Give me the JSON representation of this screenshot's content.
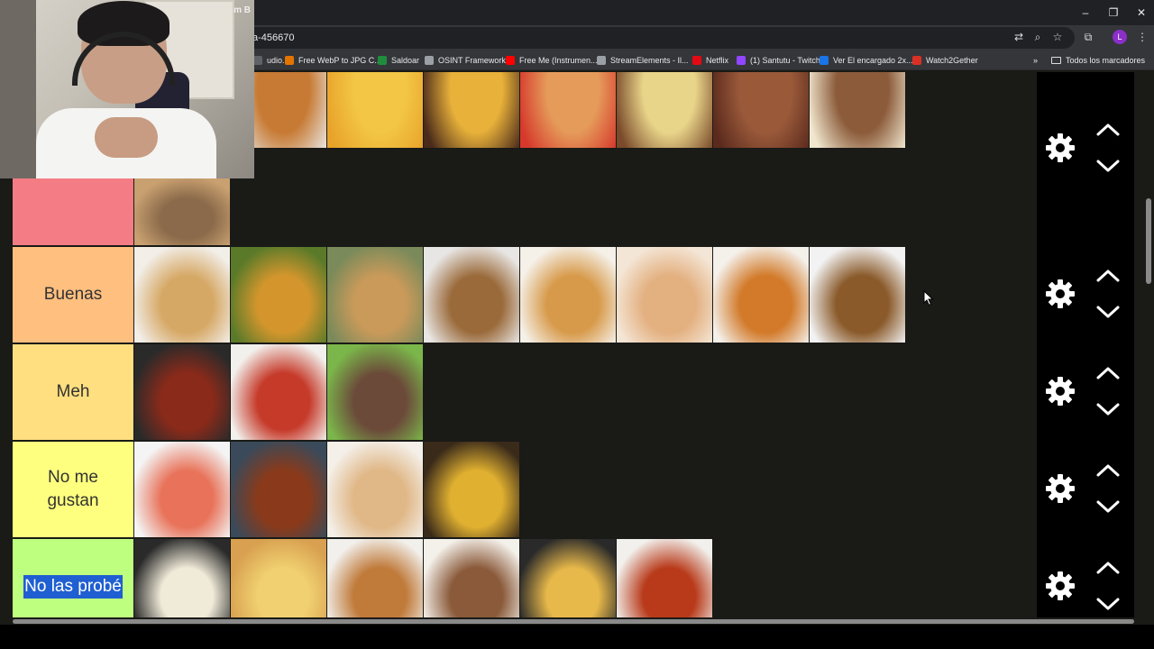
{
  "browser": {
    "url_fragment": "a-456670",
    "window_controls": {
      "minimize": "–",
      "restore": "❐",
      "close": "✕"
    },
    "profile_initial": "L",
    "bookmarks": [
      {
        "label": "udio...",
        "color": "#5f6368"
      },
      {
        "label": "Free WebP to JPG C...",
        "color": "#e37400"
      },
      {
        "label": "Saldoar",
        "color": "#1e8e3e"
      },
      {
        "label": "OSINT Framework",
        "color": "#9aa0a6"
      },
      {
        "label": "Free Me (Instrumen...",
        "color": "#ff0000"
      },
      {
        "label": "StreamElements - Il...",
        "color": "#9aa0a6"
      },
      {
        "label": "Netflix",
        "color": "#e50914"
      },
      {
        "label": "(1) Santutu - Twitch",
        "color": "#9146ff"
      },
      {
        "label": "Ver El encargado 2x...",
        "color": "#1a73e8"
      },
      {
        "label": "Watch2Gether",
        "color": "#d93025"
      }
    ],
    "bookmarks_folder": "Todos los marcadores",
    "overflow": "»"
  },
  "webcam": {
    "logo": "m B"
  },
  "tiers": [
    {
      "label": "",
      "color": "#ff7f7f",
      "items": [
        {
          "colors": [
            "#2b2b2b",
            "#c9a46a"
          ]
        },
        {
          "colors": [
            "#e8e6e2",
            "#c77a33"
          ]
        },
        {
          "colors": [
            "#e8a32a",
            "#f3c645"
          ]
        },
        {
          "colors": [
            "#4a2a1a",
            "#e8b13a"
          ]
        },
        {
          "colors": [
            "#d6392c",
            "#e59b5a"
          ]
        },
        {
          "colors": [
            "#7a4a2a",
            "#e9d58a"
          ]
        },
        {
          "colors": [
            "#5b2a1d",
            "#9a5a3a"
          ]
        },
        {
          "colors": [
            "#f1e7cf",
            "#8b5b3a"
          ]
        }
      ]
    },
    {
      "label": "",
      "color": "#f47c84",
      "items": [
        {
          "colors": [
            "#c9a070",
            "#8a6a4a"
          ]
        }
      ]
    },
    {
      "label": "Buenas",
      "color": "#ffbf7f",
      "items": [
        {
          "colors": [
            "#f2eee8",
            "#d6a865"
          ]
        },
        {
          "colors": [
            "#5a7a2a",
            "#d4962c"
          ]
        },
        {
          "colors": [
            "#7a8a5a",
            "#c99a5a"
          ]
        },
        {
          "colors": [
            "#e8e6e4",
            "#9a6a3a"
          ]
        },
        {
          "colors": [
            "#f5f0e8",
            "#d79a4a"
          ]
        },
        {
          "colors": [
            "#f4e6d6",
            "#e3b080"
          ]
        },
        {
          "colors": [
            "#f4f0ea",
            "#d27a2a"
          ]
        },
        {
          "colors": [
            "#f2f2f2",
            "#8a5a2a"
          ]
        }
      ]
    },
    {
      "label": "Meh",
      "color": "#ffdf7f",
      "items": [
        {
          "colors": [
            "#2a2a2a",
            "#8a2a1a"
          ]
        },
        {
          "colors": [
            "#f2f0ec",
            "#c63a2a"
          ]
        },
        {
          "colors": [
            "#7bb64a",
            "#6b4a3a"
          ]
        }
      ]
    },
    {
      "label": "No me gustan",
      "color": "#ffff7f",
      "items": [
        {
          "colors": [
            "#f4f4f4",
            "#e8735a"
          ]
        },
        {
          "colors": [
            "#3a4a5a",
            "#8a3a1a"
          ]
        },
        {
          "colors": [
            "#f4efe8",
            "#e0b786"
          ]
        },
        {
          "colors": [
            "#3a2a1a",
            "#e0b030"
          ]
        }
      ]
    },
    {
      "label": "No las probé",
      "color": "#bfff7f",
      "items": [
        {
          "colors": [
            "#2a2a2a",
            "#f0ead8"
          ]
        },
        {
          "colors": [
            "#d8a050",
            "#f0d070"
          ]
        },
        {
          "colors": [
            "#f2f0ec",
            "#c07a3a"
          ]
        },
        {
          "colors": [
            "#f4f0ea",
            "#8a5a3a"
          ]
        },
        {
          "colors": [
            "#2a2a2a",
            "#e7b84a"
          ]
        },
        {
          "colors": [
            "#f2f0ec",
            "#b83a1a"
          ]
        }
      ]
    }
  ]
}
